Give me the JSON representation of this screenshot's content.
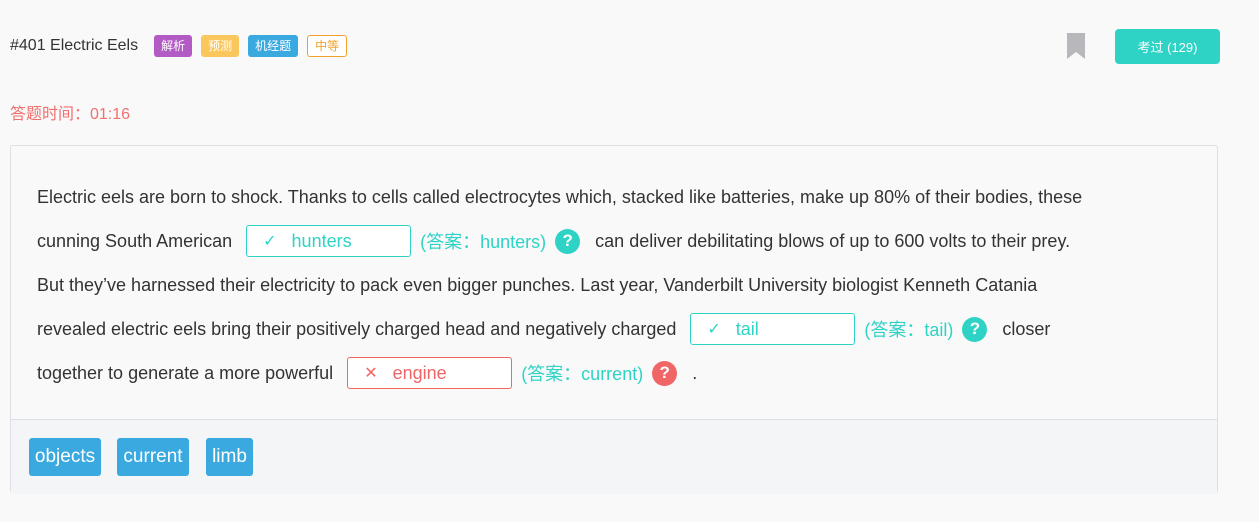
{
  "header": {
    "title": "#401 Electric Eels",
    "tags": [
      "解析",
      "预测",
      "机经题",
      "中等"
    ],
    "pass_button": "考过 (129)"
  },
  "timer": "答题时间：01:16",
  "passage": {
    "l1": "Electric eels are born to shock. Thanks to cells called electrocytes which, stacked like batteries, make up 80% of their bodies, these",
    "l2a": "cunning South American",
    "l2b": "can deliver debilitating blows of up to 600 volts to their prey.",
    "l3": "But they’ve harnessed their electricity to pack even bigger punches. Last year, Vanderbilt University biologist Kenneth Catania",
    "l4a": "revealed electric eels bring their positively charged head and negatively charged",
    "l4b": "closer",
    "l5a": "together to generate a more powerful",
    "l5b": "."
  },
  "blanks": [
    {
      "value": "hunters",
      "answer": "(答案：hunters)",
      "status": "correct"
    },
    {
      "value": "tail",
      "answer": "(答案：tail)",
      "status": "correct"
    },
    {
      "value": "engine",
      "answer": "(答案：current)",
      "status": "wrong"
    }
  ],
  "glyphs": {
    "check": "✓",
    "cross": "✕",
    "help": "?"
  },
  "word_bank": [
    "objects",
    "current",
    "limb"
  ],
  "colors": {
    "accent": "#2ed3c6",
    "error": "#f06566",
    "word_bg": "#3aa9e0"
  }
}
